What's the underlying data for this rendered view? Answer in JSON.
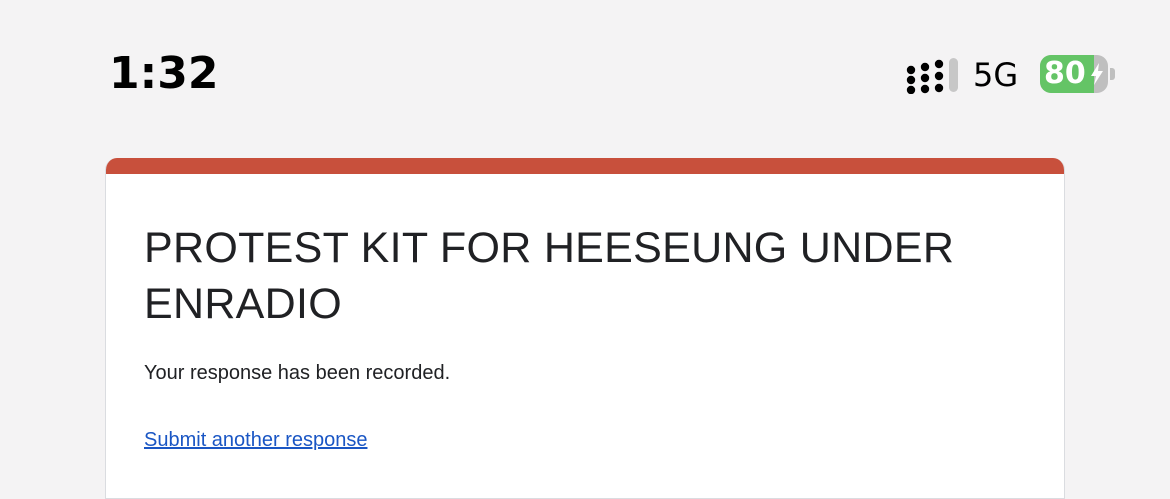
{
  "status_bar": {
    "time": "1:32",
    "network": "5G",
    "battery_level": "80",
    "battery_fraction": 0.8,
    "battery_charging": true
  },
  "form": {
    "title": "PROTEST KIT FOR HEESEUNG UNDER ENRADIO",
    "confirmation_message": "Your response has been recorded.",
    "submit_another_label": "Submit another response"
  },
  "colors": {
    "background": "#f4f3f4",
    "accent": "#c8503c",
    "battery_green": "#64c466",
    "link": "#1a56c4"
  }
}
